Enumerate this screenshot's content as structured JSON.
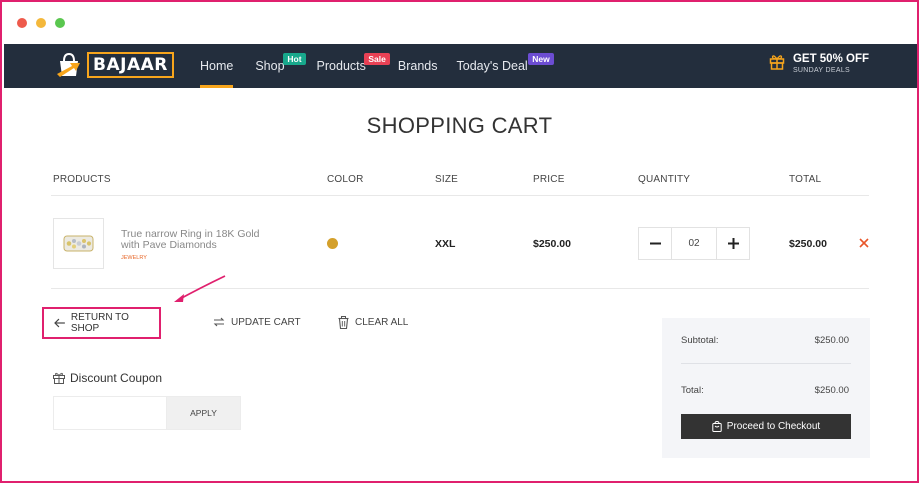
{
  "window": {
    "dots": [
      {
        "name": "close",
        "color": "#ee5a4c"
      },
      {
        "name": "minimize",
        "color": "#f4b83b"
      },
      {
        "name": "maximize",
        "color": "#5ac74f"
      }
    ]
  },
  "header": {
    "logo_text": "BAJAAR",
    "nav": [
      {
        "label": "Home",
        "active": true
      },
      {
        "label": "Shop",
        "badge": "Hot",
        "badge_color": "#18a88c"
      },
      {
        "label": "Products",
        "badge": "Sale",
        "badge_color": "#e94155"
      },
      {
        "label": "Brands"
      },
      {
        "label": "Today's Deal",
        "badge": "New",
        "badge_color": "#6c4dd3"
      }
    ],
    "deal_title": "GET 50% OFF",
    "deal_subtitle": "SUNDAY DEALS",
    "accent_color": "#f7a51c"
  },
  "page_title": "SHOPPING CART",
  "cart": {
    "columns": {
      "products": "PRODUCTS",
      "color": "COLOR",
      "size": "SIZE",
      "price": "PRICE",
      "quantity": "QUANTITY",
      "total": "TOTAL"
    },
    "items": [
      {
        "name": "True narrow Ring in 18K Gold with Pave Diamonds",
        "category": "JEWELRY",
        "color": "#d4a02b",
        "size": "XXL",
        "price": "$250.00",
        "quantity": "02",
        "total": "$250.00"
      }
    ]
  },
  "actions": {
    "return": "RETURN TO SHOP",
    "update": "UPDATE CART",
    "clear": "CLEAR ALL"
  },
  "coupon": {
    "title": "Discount Coupon",
    "placeholder": "",
    "apply": "APPLY"
  },
  "summary": {
    "subtotal_label": "Subtotal:",
    "subtotal": "$250.00",
    "total_label": "Total:",
    "total": "$250.00",
    "checkout": "Proceed to Checkout"
  },
  "annotation_color": "#e0206e"
}
